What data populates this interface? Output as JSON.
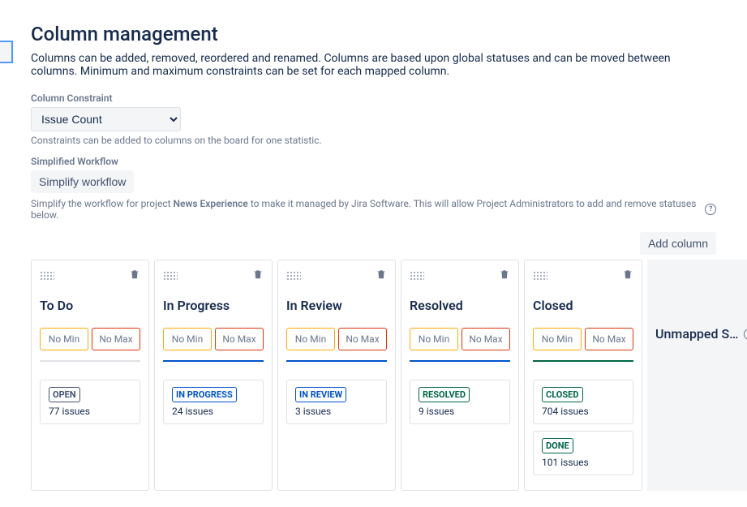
{
  "page": {
    "title": "Column management",
    "description": "Columns can be added, removed, reordered and renamed. Columns are based upon global statuses and can be moved between columns. Minimum and maximum constraints can be set for each mapped column."
  },
  "constraint": {
    "label": "Column Constraint",
    "value": "Issue Count",
    "hint": "Constraints can be added to columns on the board for one statistic."
  },
  "workflow": {
    "label": "Simplified Workflow",
    "button": "Simplify workflow",
    "hint_pre": "Simplify the workflow for project ",
    "project": "News Experience",
    "hint_post": " to make it managed by Jira Software. This will allow Project Administrators to add and remove statuses below."
  },
  "add_column": "Add column",
  "columns": [
    {
      "name": "To Do",
      "min": "No Min",
      "max": "No Max",
      "divider": "grey",
      "statuses": [
        {
          "label": "OPEN",
          "class": "default",
          "count": "77 issues"
        }
      ]
    },
    {
      "name": "In Progress",
      "min": "No Min",
      "max": "No Max",
      "divider": "blue",
      "statuses": [
        {
          "label": "IN PROGRESS",
          "class": "inprogress",
          "count": "24 issues"
        }
      ]
    },
    {
      "name": "In Review",
      "min": "No Min",
      "max": "No Max",
      "divider": "blue",
      "statuses": [
        {
          "label": "IN REVIEW",
          "class": "inprogress",
          "count": "3 issues"
        }
      ]
    },
    {
      "name": "Resolved",
      "min": "No Min",
      "max": "No Max",
      "divider": "blue",
      "statuses": [
        {
          "label": "RESOLVED",
          "class": "done",
          "count": "9 issues"
        }
      ]
    },
    {
      "name": "Closed",
      "min": "No Min",
      "max": "No Max",
      "divider": "green",
      "statuses": [
        {
          "label": "CLOSED",
          "class": "done",
          "count": "704 issues"
        },
        {
          "label": "DONE",
          "class": "done",
          "count": "101 issues"
        }
      ]
    }
  ],
  "unmapped": {
    "title": "Unmapped S…"
  }
}
